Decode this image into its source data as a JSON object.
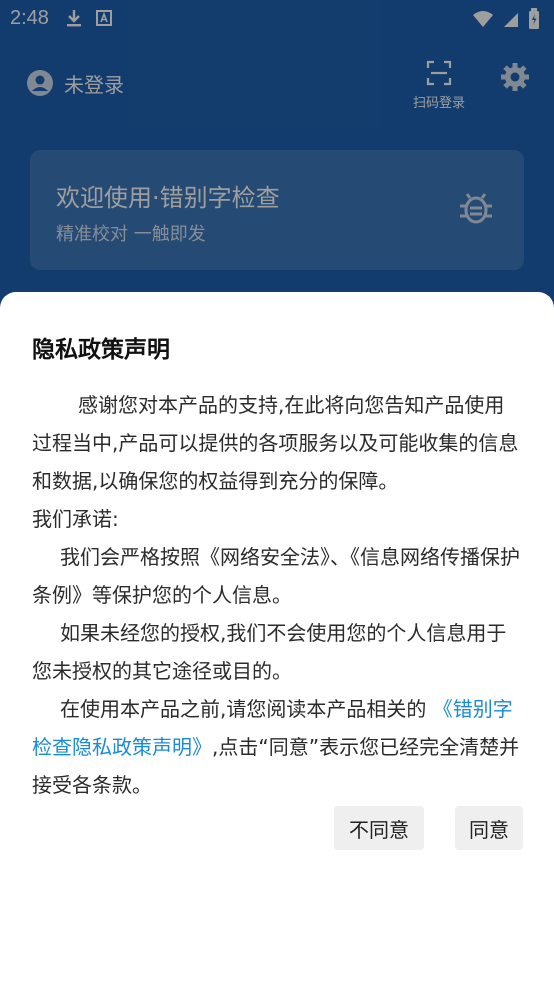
{
  "status_bar": {
    "time": "2:48",
    "icons": [
      "download-icon",
      "font-a-icon",
      "wifi-icon",
      "signal-icon",
      "battery-icon"
    ]
  },
  "header": {
    "user_label": "未登录",
    "scan_label": "扫码登录"
  },
  "welcome_card": {
    "title": "欢迎使用·错别字检查",
    "subtitle": "精准校对 一触即发"
  },
  "dialog": {
    "title": "隐私政策声明",
    "paragraph_1": "感谢您对本产品的支持,在此将向您告知产品使用过程当中,产品可以提供的各项服务以及可能收集的信息和数据,以确保您的权益得到充分的保障。",
    "paragraph_2": "我们承诺:",
    "paragraph_3": "我们会严格按照《网络安全法》、《信息网络传播保护条例》等保护您的个人信息。",
    "paragraph_4": "如果未经您的授权,我们不会使用您的个人信息用于您未授权的其它途径或目的。",
    "paragraph_5_prefix": "在使用本产品之前,请您阅读本产品相关的 ",
    "paragraph_5_link": "《错别字检查隐私政策声明》",
    "paragraph_5_suffix": ",点击“同意”表示您已经完全清楚并接受各条款。",
    "disagree_label": "不同意",
    "agree_label": "同意"
  },
  "colors": {
    "app_primary": "#1e62b0",
    "link": "#1a8bd8",
    "button_bg": "#efefef"
  }
}
